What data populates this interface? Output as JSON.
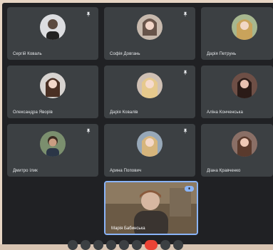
{
  "participants": [
    {
      "name": "Сергій Коваль",
      "avatar_bg": "#dcdde0"
    },
    {
      "name": "Софія Довгань",
      "avatar_bg": "#c7b9ad"
    },
    {
      "name": "Дарія Петрунь",
      "avatar_bg": "#a7b78f"
    },
    {
      "name": "Олександра Яворів",
      "avatar_bg": "#d8d4d1"
    },
    {
      "name": "Дарія Ковалів",
      "avatar_bg": "#cfc0b4"
    },
    {
      "name": "Аліна Конченська",
      "avatar_bg": "#6e4f46"
    },
    {
      "name": "Дмитро Ілик",
      "avatar_bg": "#7b8f6e"
    },
    {
      "name": "Арина Попович",
      "avatar_bg": "#97a8b8"
    },
    {
      "name": "Діана Кравченко",
      "avatar_bg": "#8a6f66"
    }
  ],
  "self": {
    "name": "Марія Бабинська"
  },
  "colors": {
    "background": "#202124",
    "tile": "#3c4043",
    "accent": "#8ab4f8",
    "end_call": "#ea4335"
  },
  "icons": {
    "pin": "push-pin-icon",
    "mic": "mic-icon",
    "end": "end-call-icon"
  }
}
